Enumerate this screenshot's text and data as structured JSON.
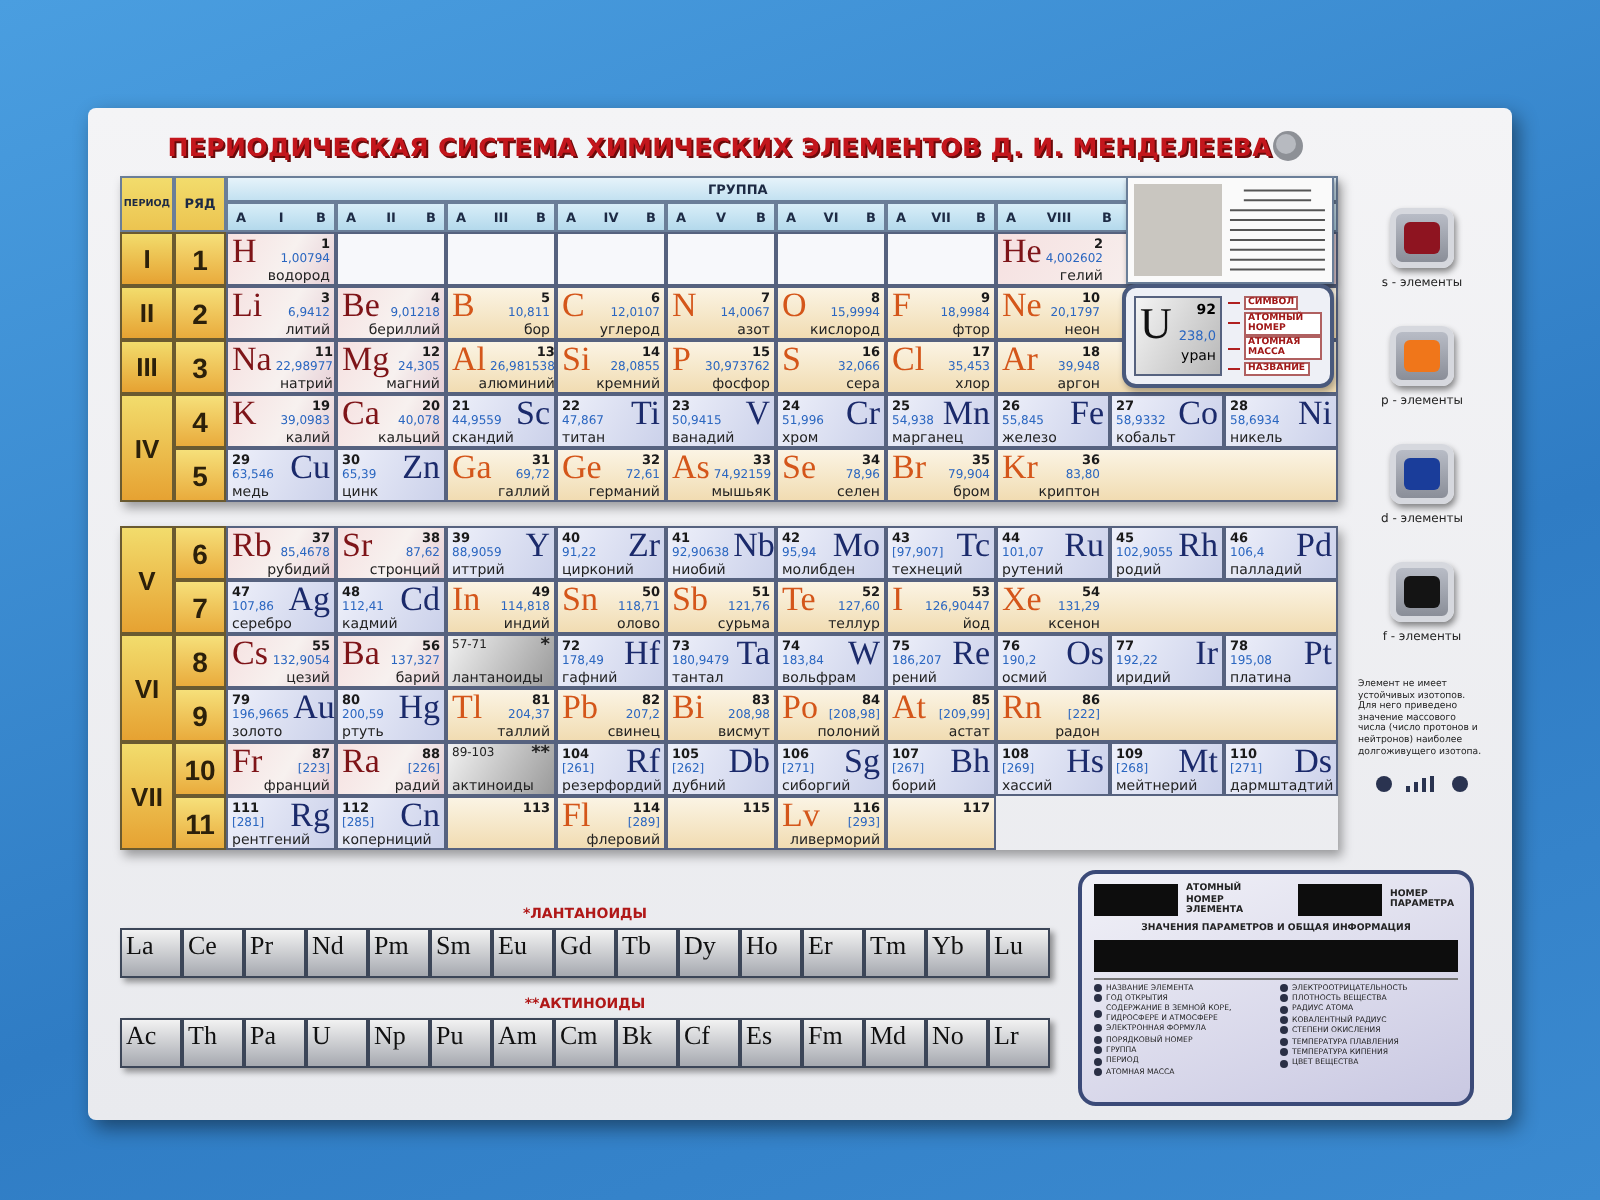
{
  "title": "ПЕРИОДИЧЕСКАЯ СИСТЕМА ХИМИЧЕСКИХ ЭЛЕМЕНТОВ Д. И. МЕНДЕЛЕЕВА",
  "header": {
    "period": "ПЕРИОД",
    "row": "РЯД",
    "group": "ГРУППА"
  },
  "groups": [
    {
      "a": "А",
      "roman": "I",
      "b": "В"
    },
    {
      "a": "А",
      "roman": "II",
      "b": "В"
    },
    {
      "a": "А",
      "roman": "III",
      "b": "В"
    },
    {
      "a": "А",
      "roman": "IV",
      "b": "В"
    },
    {
      "a": "А",
      "roman": "V",
      "b": "В"
    },
    {
      "a": "А",
      "roman": "VI",
      "b": "В"
    },
    {
      "a": "А",
      "roman": "VII",
      "b": "В"
    },
    {
      "a": "А",
      "roman": "VIII",
      "b": "В"
    }
  ],
  "top_periods": [
    {
      "label": "I",
      "rows": [
        {
          "label": "1",
          "cells": [
            {
              "kind": "s",
              "symbol": "H",
              "number": "1",
              "mass": "1,00794",
              "name": "водород"
            },
            {
              "kind": "empty"
            },
            {
              "kind": "empty"
            },
            {
              "kind": "empty"
            },
            {
              "kind": "empty"
            },
            {
              "kind": "empty"
            },
            {
              "kind": "empty"
            },
            {
              "kind": "s",
              "wide": true,
              "symbol": "He",
              "number": "2",
              "mass": "4,002602",
              "name": "гелий"
            }
          ]
        }
      ]
    },
    {
      "label": "II",
      "rows": [
        {
          "label": "2",
          "cells": [
            {
              "kind": "s",
              "symbol": "Li",
              "number": "3",
              "mass": "6,9412",
              "name": "литий"
            },
            {
              "kind": "s",
              "symbol": "Be",
              "number": "4",
              "mass": "9,01218",
              "name": "бериллий"
            },
            {
              "kind": "p",
              "symbol": "B",
              "number": "5",
              "mass": "10,811",
              "name": "бор"
            },
            {
              "kind": "p",
              "symbol": "C",
              "number": "6",
              "mass": "12,0107",
              "name": "углерод"
            },
            {
              "kind": "p",
              "symbol": "N",
              "number": "7",
              "mass": "14,0067",
              "name": "азот"
            },
            {
              "kind": "p",
              "symbol": "O",
              "number": "8",
              "mass": "15,9994",
              "name": "кислород"
            },
            {
              "kind": "p",
              "symbol": "F",
              "number": "9",
              "mass": "18,9984",
              "name": "фтор"
            },
            {
              "kind": "p",
              "wide": true,
              "symbol": "Ne",
              "number": "10",
              "mass": "20,1797",
              "name": "неон"
            }
          ]
        }
      ]
    },
    {
      "label": "III",
      "rows": [
        {
          "label": "3",
          "cells": [
            {
              "kind": "s",
              "symbol": "Na",
              "number": "11",
              "mass": "22,98977",
              "name": "натрий"
            },
            {
              "kind": "s",
              "symbol": "Mg",
              "number": "12",
              "mass": "24,305",
              "name": "магний"
            },
            {
              "kind": "p",
              "symbol": "Al",
              "number": "13",
              "mass": "26,981538",
              "name": "алюминий"
            },
            {
              "kind": "p",
              "symbol": "Si",
              "number": "14",
              "mass": "28,0855",
              "name": "кремний"
            },
            {
              "kind": "p",
              "symbol": "P",
              "number": "15",
              "mass": "30,973762",
              "name": "фосфор"
            },
            {
              "kind": "p",
              "symbol": "S",
              "number": "16",
              "mass": "32,066",
              "name": "сера"
            },
            {
              "kind": "p",
              "symbol": "Cl",
              "number": "17",
              "mass": "35,453",
              "name": "хлор"
            },
            {
              "kind": "p",
              "wide": true,
              "symbol": "Ar",
              "number": "18",
              "mass": "39,948",
              "name": "аргон"
            }
          ]
        }
      ]
    },
    {
      "label": "IV",
      "rows": [
        {
          "label": "4",
          "cells": [
            {
              "kind": "s",
              "symbol": "K",
              "number": "19",
              "mass": "39,0983",
              "name": "калий"
            },
            {
              "kind": "s",
              "symbol": "Ca",
              "number": "20",
              "mass": "40,078",
              "name": "кальций"
            },
            {
              "kind": "d",
              "symbol": "Sc",
              "number": "21",
              "mass": "44,9559",
              "name": "скандий"
            },
            {
              "kind": "d",
              "symbol": "Ti",
              "number": "22",
              "mass": "47,867",
              "name": "титан"
            },
            {
              "kind": "d",
              "symbol": "V",
              "number": "23",
              "mass": "50,9415",
              "name": "ванадий"
            },
            {
              "kind": "d",
              "symbol": "Cr",
              "number": "24",
              "mass": "51,996",
              "name": "хром"
            },
            {
              "kind": "d",
              "symbol": "Mn",
              "number": "25",
              "mass": "54,938",
              "name": "марганец"
            },
            {
              "kind": "d",
              "symbol": "Fe",
              "number": "26",
              "mass": "55,845",
              "name": "железо"
            },
            {
              "kind": "d",
              "symbol": "Co",
              "number": "27",
              "mass": "58,9332",
              "name": "кобальт"
            },
            {
              "kind": "d",
              "symbol": "Ni",
              "number": "28",
              "mass": "58,6934",
              "name": "никель"
            }
          ]
        },
        {
          "label": "5",
          "cells": [
            {
              "kind": "d",
              "symbol": "Cu",
              "number": "29",
              "mass": "63,546",
              "name": "медь"
            },
            {
              "kind": "d",
              "symbol": "Zn",
              "number": "30",
              "mass": "65,39",
              "name": "цинк"
            },
            {
              "kind": "p",
              "symbol": "Ga",
              "number": "31",
              "mass": "69,72",
              "name": "галлий"
            },
            {
              "kind": "p",
              "symbol": "Ge",
              "number": "32",
              "mass": "72,61",
              "name": "германий"
            },
            {
              "kind": "p",
              "symbol": "As",
              "number": "33",
              "mass": "74,92159",
              "name": "мышьяк"
            },
            {
              "kind": "p",
              "symbol": "Se",
              "number": "34",
              "mass": "78,96",
              "name": "селен"
            },
            {
              "kind": "p",
              "symbol": "Br",
              "number": "35",
              "mass": "79,904",
              "name": "бром"
            },
            {
              "kind": "p",
              "wide": true,
              "symbol": "Kr",
              "number": "36",
              "mass": "83,80",
              "name": "криптон"
            }
          ]
        }
      ]
    }
  ],
  "bottom_periods": [
    {
      "label": "V",
      "rows": [
        {
          "label": "6",
          "cells": [
            {
              "kind": "s",
              "symbol": "Rb",
              "number": "37",
              "mass": "85,4678",
              "name": "рубидий"
            },
            {
              "kind": "s",
              "symbol": "Sr",
              "number": "38",
              "mass": "87,62",
              "name": "стронций"
            },
            {
              "kind": "d",
              "symbol": "Y",
              "number": "39",
              "mass": "88,9059",
              "name": "иттрий"
            },
            {
              "kind": "d",
              "symbol": "Zr",
              "number": "40",
              "mass": "91,22",
              "name": "цирконий"
            },
            {
              "kind": "d",
              "symbol": "Nb",
              "number": "41",
              "mass": "92,90638",
              "name": "ниобий"
            },
            {
              "kind": "d",
              "symbol": "Mo",
              "number": "42",
              "mass": "95,94",
              "name": "молибден"
            },
            {
              "kind": "d",
              "symbol": "Tc",
              "number": "43",
              "mass": "[97,907]",
              "name": "технеций"
            },
            {
              "kind": "d",
              "symbol": "Ru",
              "number": "44",
              "mass": "101,07",
              "name": "рутений"
            },
            {
              "kind": "d",
              "symbol": "Rh",
              "number": "45",
              "mass": "102,9055",
              "name": "родий"
            },
            {
              "kind": "d",
              "symbol": "Pd",
              "number": "46",
              "mass": "106,4",
              "name": "палладий"
            }
          ]
        },
        {
          "label": "7",
          "cells": [
            {
              "kind": "d",
              "symbol": "Ag",
              "number": "47",
              "mass": "107,86",
              "name": "серебро"
            },
            {
              "kind": "d",
              "symbol": "Cd",
              "number": "48",
              "mass": "112,41",
              "name": "кадмий"
            },
            {
              "kind": "p",
              "symbol": "In",
              "number": "49",
              "mass": "114,818",
              "name": "индий"
            },
            {
              "kind": "p",
              "symbol": "Sn",
              "number": "50",
              "mass": "118,71",
              "name": "олово"
            },
            {
              "kind": "p",
              "symbol": "Sb",
              "number": "51",
              "mass": "121,76",
              "name": "сурьма"
            },
            {
              "kind": "p",
              "symbol": "Te",
              "number": "52",
              "mass": "127,60",
              "name": "теллур"
            },
            {
              "kind": "p",
              "symbol": "I",
              "number": "53",
              "mass": "126,90447",
              "name": "йод"
            },
            {
              "kind": "p",
              "wide": true,
              "symbol": "Xe",
              "number": "54",
              "mass": "131,29",
              "name": "ксенон"
            }
          ]
        }
      ]
    },
    {
      "label": "VI",
      "rows": [
        {
          "label": "8",
          "cells": [
            {
              "kind": "s",
              "symbol": "Cs",
              "number": "55",
              "mass": "132,9054",
              "name": "цезий"
            },
            {
              "kind": "s",
              "symbol": "Ba",
              "number": "56",
              "mass": "137,327",
              "name": "барий"
            },
            {
              "kind": "range",
              "range": "57-71",
              "mark": "*",
              "name": "лантаноиды"
            },
            {
              "kind": "d",
              "symbol": "Hf",
              "number": "72",
              "mass": "178,49",
              "name": "гафний"
            },
            {
              "kind": "d",
              "symbol": "Ta",
              "number": "73",
              "mass": "180,9479",
              "name": "тантал"
            },
            {
              "kind": "d",
              "symbol": "W",
              "number": "74",
              "mass": "183,84",
              "name": "вольфрам"
            },
            {
              "kind": "d",
              "symbol": "Re",
              "number": "75",
              "mass": "186,207",
              "name": "рений"
            },
            {
              "kind": "d",
              "symbol": "Os",
              "number": "76",
              "mass": "190,2",
              "name": "осмий"
            },
            {
              "kind": "d",
              "symbol": "Ir",
              "number": "77",
              "mass": "192,22",
              "name": "иридий"
            },
            {
              "kind": "d",
              "symbol": "Pt",
              "number": "78",
              "mass": "195,08",
              "name": "платина"
            }
          ]
        },
        {
          "label": "9",
          "cells": [
            {
              "kind": "d",
              "symbol": "Au",
              "number": "79",
              "mass": "196,9665",
              "name": "золото"
            },
            {
              "kind": "d",
              "symbol": "Hg",
              "number": "80",
              "mass": "200,59",
              "name": "ртуть"
            },
            {
              "kind": "p",
              "symbol": "Tl",
              "number": "81",
              "mass": "204,37",
              "name": "таллий"
            },
            {
              "kind": "p",
              "symbol": "Pb",
              "number": "82",
              "mass": "207,2",
              "name": "свинец"
            },
            {
              "kind": "p",
              "symbol": "Bi",
              "number": "83",
              "mass": "208,98",
              "name": "висмут"
            },
            {
              "kind": "p",
              "symbol": "Po",
              "number": "84",
              "mass": "[208,98]",
              "name": "полоний"
            },
            {
              "kind": "p",
              "symbol": "At",
              "number": "85",
              "mass": "[209,99]",
              "name": "астат"
            },
            {
              "kind": "p",
              "wide": true,
              "symbol": "Rn",
              "number": "86",
              "mass": "[222]",
              "name": "радон"
            }
          ]
        }
      ]
    },
    {
      "label": "VII",
      "rows": [
        {
          "label": "10",
          "cells": [
            {
              "kind": "s",
              "symbol": "Fr",
              "number": "87",
              "mass": "[223]",
              "name": "франций"
            },
            {
              "kind": "s",
              "symbol": "Ra",
              "number": "88",
              "mass": "[226]",
              "name": "радий"
            },
            {
              "kind": "range",
              "range": "89-103",
              "mark": "**",
              "name": "актиноиды"
            },
            {
              "kind": "d",
              "symbol": "Rf",
              "number": "104",
              "mass": "[261]",
              "name": "резерфордий"
            },
            {
              "kind": "d",
              "symbol": "Db",
              "number": "105",
              "mass": "[262]",
              "name": "дубний"
            },
            {
              "kind": "d",
              "symbol": "Sg",
              "number": "106",
              "mass": "[271]",
              "name": "сиборгий"
            },
            {
              "kind": "d",
              "symbol": "Bh",
              "number": "107",
              "mass": "[267]",
              "name": "борий"
            },
            {
              "kind": "d",
              "symbol": "Hs",
              "number": "108",
              "mass": "[269]",
              "name": "хассий"
            },
            {
              "kind": "d",
              "symbol": "Mt",
              "number": "109",
              "mass": "[268]",
              "name": "мейтнерий"
            },
            {
              "kind": "d",
              "symbol": "Ds",
              "number": "110",
              "mass": "[271]",
              "name": "дармштадтий"
            }
          ]
        },
        {
          "label": "11",
          "cells": [
            {
              "kind": "d",
              "symbol": "Rg",
              "number": "111",
              "mass": "[281]",
              "name": "рентгений"
            },
            {
              "kind": "d",
              "symbol": "Cn",
              "number": "112",
              "mass": "[285]",
              "name": "коперниций"
            },
            {
              "kind": "vacant",
              "number": "113"
            },
            {
              "kind": "p",
              "symbol": "Fl",
              "number": "114",
              "mass": "[289]",
              "name": "флеровий"
            },
            {
              "kind": "vacant",
              "number": "115"
            },
            {
              "kind": "p",
              "symbol": "Lv",
              "number": "116",
              "mass": "[293]",
              "name": "ливерморий"
            },
            {
              "kind": "vacant",
              "number": "117"
            }
          ]
        }
      ]
    }
  ],
  "key": {
    "symbol": "U",
    "number": "92",
    "mass": "238,0",
    "name": "уран",
    "labels": [
      "СИМВОЛ",
      "АТОМНЫЙ НОМЕР",
      "АТОМНАЯ МАССА",
      "НАЗВАНИЕ"
    ]
  },
  "legend": [
    {
      "kind": "s",
      "label": "s - элементы"
    },
    {
      "kind": "p",
      "label": "p - элементы"
    },
    {
      "kind": "d",
      "label": "d - элементы"
    },
    {
      "kind": "f",
      "label": "f - элементы"
    }
  ],
  "footnote": "Элемент не имеет устойчивых изотопов. Для него приведено значение массового числа (число протонов и нейтронов) наиболее долгоживущего изотопа.",
  "lanthanides": {
    "label": "*ЛАНТАНОИДЫ",
    "symbols": [
      "La",
      "Ce",
      "Pr",
      "Nd",
      "Pm",
      "Sm",
      "Eu",
      "Gd",
      "Tb",
      "Dy",
      "Ho",
      "Er",
      "Tm",
      "Yb",
      "Lu"
    ]
  },
  "actinides": {
    "label": "**АКТИНОИДЫ",
    "symbols": [
      "Ac",
      "Th",
      "Pa",
      "U",
      "Np",
      "Pu",
      "Am",
      "Cm",
      "Bk",
      "Cf",
      "Es",
      "Fm",
      "Md",
      "No",
      "Lr"
    ]
  },
  "info_panel": {
    "element_label": "АТОМНЫЙ НОМЕР ЭЛЕМЕНТА",
    "parameter_label": "НОМЕР ПАРАМЕТРА",
    "values_label": "ЗНАЧЕНИЯ ПАРАМЕТРОВ И ОБЩАЯ ИНФОРМАЦИЯ",
    "left_items": [
      "НАЗВАНИЕ ЭЛЕМЕНТА",
      "ГОД ОТКРЫТИЯ",
      "СОДЕРЖАНИЕ В ЗЕМНОЙ КОРЕ, ГИДРОСФЕРЕ И АТМОСФЕРЕ",
      "ЭЛЕКТРОННАЯ ФОРМУЛА",
      "ПОРЯДКОВЫЙ НОМЕР",
      "ГРУППА",
      "ПЕРИОД",
      "АТОМНАЯ МАССА"
    ],
    "right_items": [
      "ЭЛЕКТРООТРИЦАТЕЛЬНОСТЬ",
      "ПЛОТНОСТЬ ВЕЩЕСТВА",
      "РАДИУС АТОМА",
      "КОВАЛЕНТНЫЙ РАДИУС",
      "СТЕПЕНИ ОКИСЛЕНИЯ",
      "ТЕМПЕРАТУРА ПЛАВЛЕНИЯ",
      "ТЕМПЕРАТУРА КИПЕНИЯ",
      "ЦВЕТ ВЕЩЕСТВА"
    ]
  }
}
